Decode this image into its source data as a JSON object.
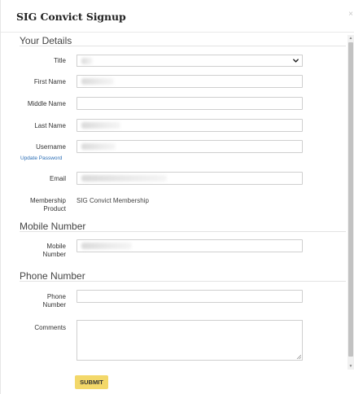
{
  "dialog": {
    "title": "SIG Convict Signup",
    "close_glyph": "×"
  },
  "sections": {
    "your_details": "Your Details",
    "mobile_number": "Mobile Number",
    "phone_number": "Phone Number"
  },
  "fields": {
    "title_label": "Title",
    "first_name_label": "First Name",
    "middle_name_label": "Middle Name",
    "last_name_label": "Last Name",
    "username_label": "Username",
    "update_password_link": "Update Password",
    "email_label": "Email",
    "membership_label_line1": "Membership",
    "membership_label_line2": "Product",
    "membership_value": "SIG Convict Membership",
    "mobile_label_line1": "Mobile",
    "mobile_label_line2": "Number",
    "phone_label_line1": "Phone",
    "phone_label_line2": "Number",
    "comments_label": "Comments"
  },
  "footer": {
    "submit_label": "SUBMIT"
  },
  "icons": {
    "select_chevron": "chevron-down-icon",
    "resize": "resize-grip-icon",
    "close": "close-icon"
  },
  "colors": {
    "submit_bg": "#f3d86a",
    "link": "#2a6db5"
  }
}
